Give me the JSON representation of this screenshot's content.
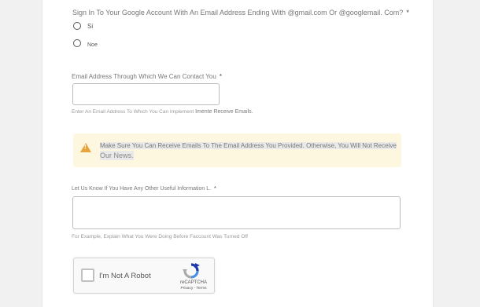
{
  "form": {
    "question_google": {
      "label": "Sign In To Your Google Account With An Email Address Ending With @gmail.com Or @googlemail. Com?",
      "required_mark": "*",
      "options": [
        {
          "label": "Si"
        },
        {
          "label": "Noe"
        }
      ]
    },
    "email": {
      "label": "Email Address Through Which We Can Contact You",
      "required_mark": "*",
      "value": "",
      "hint_prefix": "Enter An Email Address To Which You Can Implement",
      "hint_suffix": "Imente Receive Emails."
    },
    "alert": {
      "icon": "warning-icon",
      "icon_color": "#e8a33a",
      "background": "#fdf7df",
      "line1": "Make Sure You Can Receive Emails To The Email Address You Provided. Otherwise, You Will Not Receive",
      "line2": "Our News."
    },
    "info": {
      "label": "Let Us Know If You Have Any Other Useful Information L.",
      "required_mark": "*",
      "value": "",
      "hint": "For Example, Explain What You Were Doing Before Faccount Was Turned Off"
    },
    "captcha": {
      "label": "I'm Not A Robot",
      "brand": "reCAPTCHA",
      "links": "Privacy - Terms"
    }
  }
}
